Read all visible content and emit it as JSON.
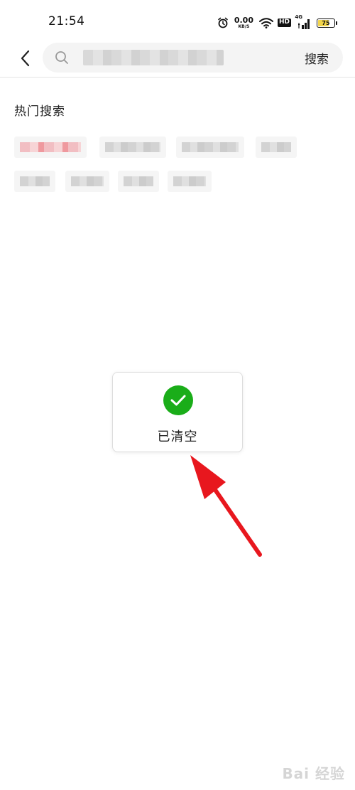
{
  "status_bar": {
    "time": "21:54",
    "net_speed_value": "0.00",
    "net_speed_unit": "KB/S",
    "hd_label": "HD",
    "network_type": "4G",
    "battery_level": "75",
    "battery_fraction": 0.75,
    "icons": [
      "alarm-icon",
      "wifi-icon",
      "signal-icon",
      "battery-icon"
    ]
  },
  "top_bar": {
    "back_icon": "chevron-left-icon",
    "search_icon": "search-icon",
    "search_value": "",
    "search_button_label": "搜索"
  },
  "hot_search": {
    "title": "热门搜索"
  },
  "toast": {
    "icon": "check-circle-icon",
    "icon_color": "#1aad19",
    "message": "已清空"
  },
  "annotation": {
    "arrow_color": "#e8171e"
  },
  "watermark": {
    "text": "Bai 经验"
  }
}
